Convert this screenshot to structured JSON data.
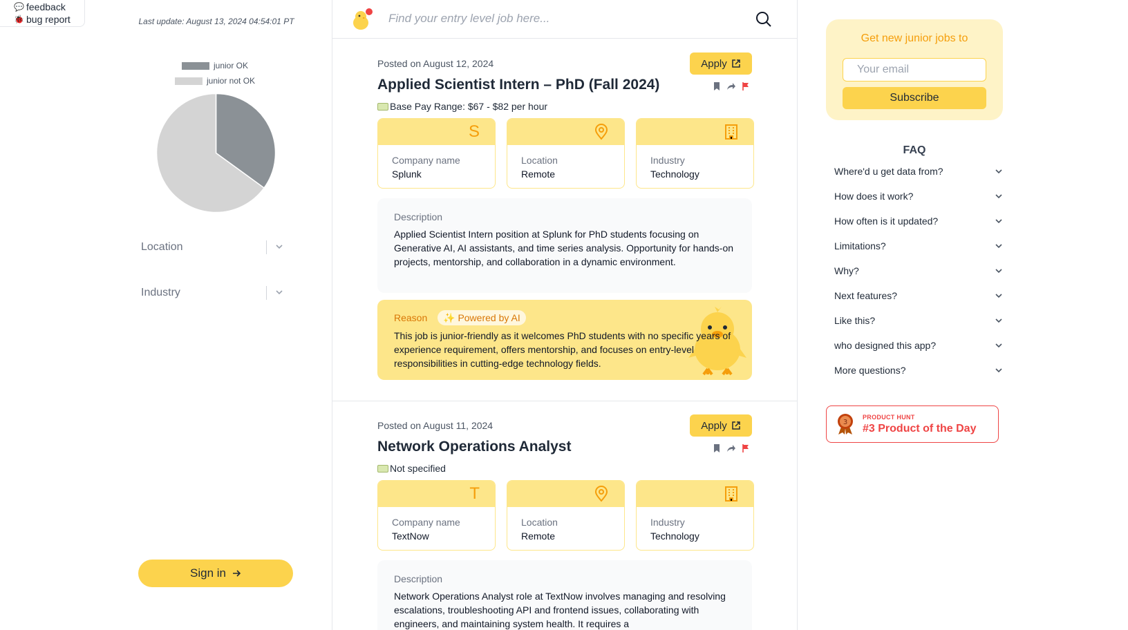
{
  "feedback": {
    "feedback_label": "feedback",
    "bug_label": "bug report"
  },
  "sidebar": {
    "last_update": "Last update: August 13, 2024 04:54:01 PT",
    "legend": [
      {
        "label": "junior OK",
        "color": "#8b9196"
      },
      {
        "label": "junior not OK",
        "color": "#d4d4d4"
      }
    ],
    "location_placeholder": "Location",
    "industry_placeholder": "Industry",
    "signin_label": "Sign in"
  },
  "chart_data": {
    "type": "pie",
    "categories": [
      "junior OK",
      "junior not OK"
    ],
    "values": [
      35,
      65
    ],
    "colors": [
      "#8b9196",
      "#d4d4d4"
    ],
    "legend_position": "top"
  },
  "search": {
    "placeholder": "Find your entry level job here..."
  },
  "jobs": [
    {
      "posted": "Posted on August 12, 2024",
      "apply_label": "Apply",
      "title": "Applied Scientist Intern – PhD (Fall 2024)",
      "pay": "Base Pay Range: $67 - $82 per hour",
      "company_icon": "S",
      "company_label": "Company name",
      "company": "Splunk",
      "location_label": "Location",
      "location": "Remote",
      "industry_label": "Industry",
      "industry": "Technology",
      "description_label": "Description",
      "description": "Applied Scientist Intern position at Splunk for PhD students focusing on Generative AI, AI assistants, and time series analysis. Opportunity for hands-on projects, mentorship, and collaboration in a dynamic environment.",
      "reason_label": "Reason",
      "ai_badge": "Powered by AI",
      "reason": "This job is junior-friendly as it welcomes PhD students with no specific years of experience requirement, offers mentorship, and focuses on entry-level responsibilities in cutting-edge technology fields."
    },
    {
      "posted": "Posted on August 11, 2024",
      "apply_label": "Apply",
      "title": "Network Operations Analyst",
      "pay": "Not specified",
      "company_icon": "T",
      "company_label": "Company name",
      "company": "TextNow",
      "location_label": "Location",
      "location": "Remote",
      "industry_label": "Industry",
      "industry": "Technology",
      "description_label": "Description",
      "description": "Network Operations Analyst role at TextNow involves managing and resolving escalations, troubleshooting API and frontend issues, collaborating with engineers, and maintaining system health. It requires a"
    }
  ],
  "subscribe": {
    "title": "Get new junior jobs to",
    "email_placeholder": "Your email",
    "button_label": "Subscribe"
  },
  "faq": {
    "title": "FAQ",
    "items": [
      "Where'd u get data from?",
      "How does it work?",
      "How often is it updated?",
      "Limitations?",
      "Why?",
      "Next features?",
      "Like this?",
      "who designed this app?",
      "More questions?"
    ]
  },
  "product_hunt": {
    "tag": "PRODUCT HUNT",
    "text": "#3 Product of the Day",
    "rank": "3"
  },
  "colors": {
    "accent": "#fcd34d",
    "accent_light": "#fde68a",
    "orange": "#f59e0b",
    "red": "#ef4444"
  }
}
